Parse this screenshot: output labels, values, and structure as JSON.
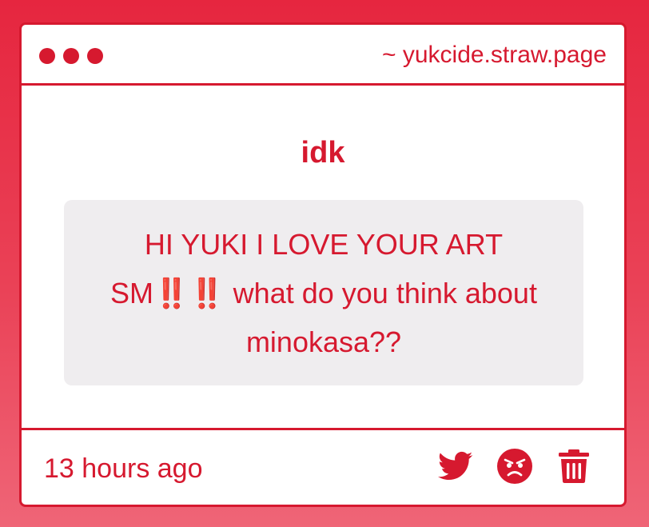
{
  "window": {
    "url": "~ yukcide.straw.page"
  },
  "prompt": {
    "title": "idk"
  },
  "message": {
    "text": "HI YUKI I LOVE YOUR ART SM‼️‼️ what do you think about minokasa??"
  },
  "footer": {
    "timestamp": "13 hours ago"
  },
  "icons": {
    "share": "twitter-icon",
    "react": "angry-face-icon",
    "delete": "trash-icon"
  },
  "colors": {
    "accent": "#d6192f",
    "message_background": "#efedef"
  }
}
